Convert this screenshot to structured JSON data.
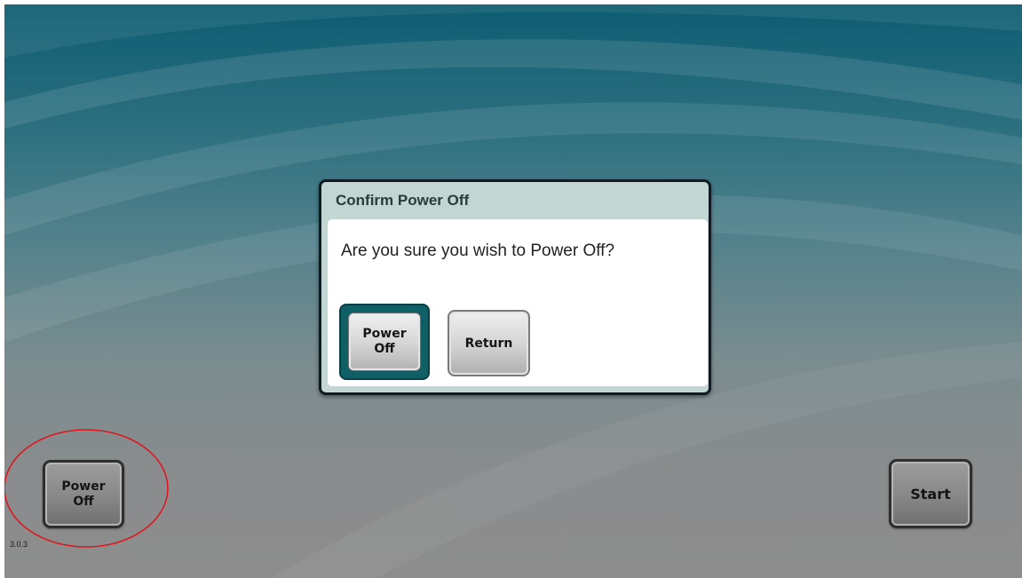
{
  "dialog": {
    "title": "Confirm Power Off",
    "message": "Are you sure you wish to Power Off?",
    "power_off_label": "Power\nOff",
    "return_label": "Return"
  },
  "main": {
    "power_off_label": "Power\nOff",
    "start_label": "Start",
    "version": "3.0.3"
  },
  "colors": {
    "background_top": "#0d5c72",
    "background_bottom": "#8d8d8d",
    "dialog_header": "#c2d6d3",
    "primary_button_ring": "#0e5f66",
    "annotation": "#e0141a"
  },
  "annotation": {
    "shape": "ellipse",
    "target": "power-off-button"
  }
}
